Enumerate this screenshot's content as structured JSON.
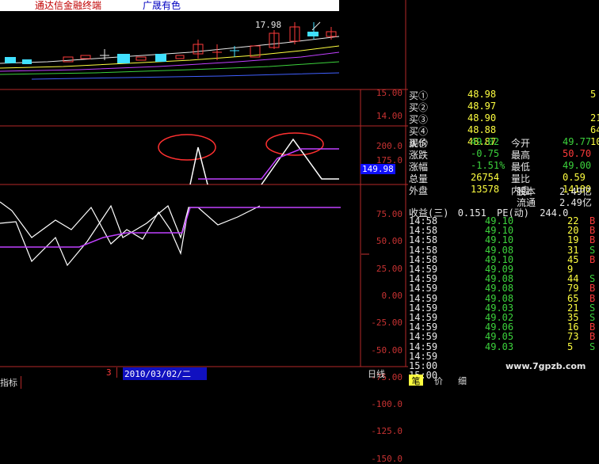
{
  "titlebar": {
    "app": "通达信金融终端",
    "stock": "广晟有色"
  },
  "kline": {
    "high_label": "17.98"
  },
  "indicator1": {
    "axis": [
      "15.00",
      "14.00"
    ]
  },
  "indicator2": {
    "axis": [
      "200.0",
      "175.0",
      "150.0"
    ],
    "current": "149.98"
  },
  "indicator3": {
    "axis": [
      "75.00",
      "50.00",
      "25.00",
      "0.00",
      "-25.00",
      "-50.00",
      "-75.00",
      "-100.0",
      "-125.0",
      "-150.0"
    ]
  },
  "orderbook": {
    "rows": [
      {
        "label": "买①",
        "price": "48.98",
        "vol": "5"
      },
      {
        "label": "买②",
        "price": "48.97",
        "vol": ""
      },
      {
        "label": "买③",
        "price": "48.90",
        "vol": "21"
      },
      {
        "label": "买④",
        "price": "48.88",
        "vol": "64"
      },
      {
        "label": "买⑤",
        "price": "48.87",
        "vol": "10"
      }
    ]
  },
  "quote": {
    "rows": [
      {
        "l1": "现价",
        "v1": "49.02",
        "l2": "今开",
        "v2": "49.77"
      },
      {
        "l1": "涨跌",
        "v1": "-0.75",
        "l2": "最高",
        "v2": "50.70"
      },
      {
        "l1": "涨幅",
        "v1": "-1.51%",
        "l2": "最低",
        "v2": "49.00"
      },
      {
        "l1": "总量",
        "v1": "26754",
        "l2": "量比",
        "v2": "0.59"
      },
      {
        "l1": "外盘",
        "v1": "13578",
        "l2": "内盘",
        "v2": "14180"
      }
    ],
    "equity": [
      {
        "label": "股本",
        "value": "2.49亿"
      },
      {
        "label": "流通",
        "value": "2.49亿"
      }
    ],
    "eps_label": "收益(三)",
    "eps": "0.151",
    "pe_label": "PE(动)",
    "pe": "244.0"
  },
  "ticks": [
    {
      "time": "14:58",
      "price": "49.10",
      "vol": "22",
      "dir": "B"
    },
    {
      "time": "14:58",
      "price": "49.10",
      "vol": "20",
      "dir": "B"
    },
    {
      "time": "14:58",
      "price": "49.10",
      "vol": "19",
      "dir": "B"
    },
    {
      "time": "14:58",
      "price": "49.08",
      "vol": "31",
      "dir": "S"
    },
    {
      "time": "14:58",
      "price": "49.10",
      "vol": "45",
      "dir": "B"
    },
    {
      "time": "14:59",
      "price": "49.09",
      "vol": "9",
      "dir": ""
    },
    {
      "time": "14:59",
      "price": "49.08",
      "vol": "44",
      "dir": "S"
    },
    {
      "time": "14:59",
      "price": "49.08",
      "vol": "79",
      "dir": "B"
    },
    {
      "time": "14:59",
      "price": "49.08",
      "vol": "65",
      "dir": "B"
    },
    {
      "time": "14:59",
      "price": "49.03",
      "vol": "21",
      "dir": "S"
    },
    {
      "time": "14:59",
      "price": "49.02",
      "vol": "35",
      "dir": "S"
    },
    {
      "time": "14:59",
      "price": "49.06",
      "vol": "16",
      "dir": "B"
    },
    {
      "time": "14:59",
      "price": "49.05",
      "vol": "73",
      "dir": "B"
    },
    {
      "time": "14:59",
      "price": "49.03",
      "vol": "5",
      "dir": "S"
    },
    {
      "time": "14:59",
      "price": "",
      "vol": "",
      "dir": ""
    },
    {
      "time": "15:00",
      "price": "",
      "vol": "",
      "dir": ""
    },
    {
      "time": "15:00",
      "price": "",
      "vol": "",
      "dir": ""
    }
  ],
  "bottom": {
    "left_tab": "指标",
    "count": "3",
    "date": "2010/03/02/二",
    "period": "日线",
    "tabs": [
      "笔",
      "价",
      "细"
    ],
    "watermark": "www.7gpzb.com"
  },
  "colors": {
    "up": "#ff3b3b",
    "down": "#3cd23c",
    "frame": "#b42828",
    "line_white": "#ffffff",
    "line_purple": "#c040ff"
  }
}
